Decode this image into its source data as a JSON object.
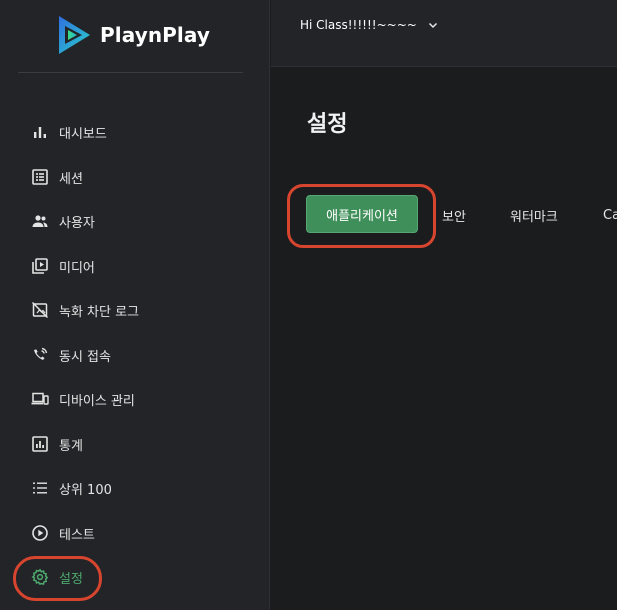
{
  "brand": {
    "name": "PlaynPlay"
  },
  "header": {
    "greeting": "Hi Class!!!!!!~~~~"
  },
  "sidebar": {
    "items": [
      {
        "label": "대시보드",
        "icon": "bar-chart-icon"
      },
      {
        "label": "세션",
        "icon": "list-alt-icon"
      },
      {
        "label": "사용자",
        "icon": "people-icon"
      },
      {
        "label": "미디어",
        "icon": "video-library-icon"
      },
      {
        "label": "녹화 차단 로그",
        "icon": "no-video-icon"
      },
      {
        "label": "동시 접속",
        "icon": "wifi-calling-icon"
      },
      {
        "label": "디바이스 관리",
        "icon": "devices-icon"
      },
      {
        "label": "통계",
        "icon": "analytics-icon"
      },
      {
        "label": "상위 100",
        "icon": "list-numbered-icon"
      },
      {
        "label": "테스트",
        "icon": "play-circle-icon"
      },
      {
        "label": "설정",
        "icon": "settings-icon"
      }
    ],
    "active_index": 10
  },
  "main": {
    "title": "설정",
    "tabs": [
      {
        "label": "애플리케이션",
        "active": true
      },
      {
        "label": "보안",
        "active": false
      },
      {
        "label": "워터마크",
        "active": false
      },
      {
        "label": "Ca",
        "active": false
      }
    ]
  },
  "colors": {
    "accent": "#3f8f5a",
    "active_text": "#4ea86e",
    "highlight": "#d7452f",
    "sidebar_bg": "#222427",
    "main_bg": "#1b1c1e"
  }
}
